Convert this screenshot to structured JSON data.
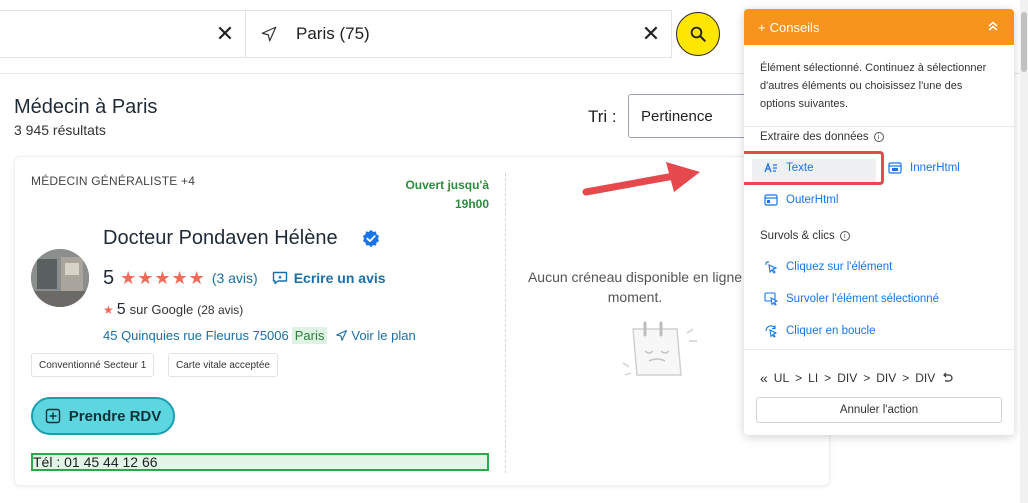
{
  "search": {
    "where_value": "Paris (75)"
  },
  "results": {
    "title": "Médecin à Paris",
    "count": "3 945 résultats",
    "sort_label": "Tri :",
    "sort_value": "Pertinence"
  },
  "doctor": {
    "specialty": "MÉDECIN GÉNÉRALISTE +4",
    "open_line1": "Ouvert jusqu'à",
    "open_line2": "19h00",
    "name": "Docteur Pondaven Hélène",
    "rating": "5",
    "stars": "★★★★★",
    "reviews": "(3 avis)",
    "write_review": "Ecrire un avis",
    "google_rating": "5",
    "google_label": "sur Google",
    "google_count": "(28 avis)",
    "address": "45 Quinquies rue Fleurus 75006",
    "city": "Paris",
    "map_link": "Voir le plan",
    "tags": [
      "Conventionné Secteur 1",
      "Carte vitale acceptée"
    ],
    "rdv_button": "Prendre RDV",
    "phone": "Tél : 01 45 44 12 66",
    "no_slot_line1": "Aucun créneau disponible en ligne",
    "no_slot_line2": "moment."
  },
  "panel": {
    "title": "Conseils",
    "intro": "Élément sélectionné. Continuez à sélectionner d'autres éléments ou choisissez l'une des options suivantes.",
    "extract_title": "Extraire des données",
    "actions_extract": [
      "Texte",
      "InnerHtml",
      "OuterHtml"
    ],
    "hover_title": "Survols & clics",
    "actions_hover": [
      "Cliquez sur l'élément",
      "Survoler l'élément sélectionné",
      "Cliquer en boucle"
    ],
    "path": [
      "UL",
      "LI",
      "DIV",
      "DIV",
      "DIV"
    ],
    "undo": "Annuler l'action",
    "accent_color": "#f7941d"
  },
  "colors": {
    "search_button": "#ffe600",
    "rdv_button": "#5dd6e0",
    "link": "#1a6fa8",
    "star": "#f26a5a",
    "open": "#2e8b3e",
    "annotation": "#e5484d"
  }
}
